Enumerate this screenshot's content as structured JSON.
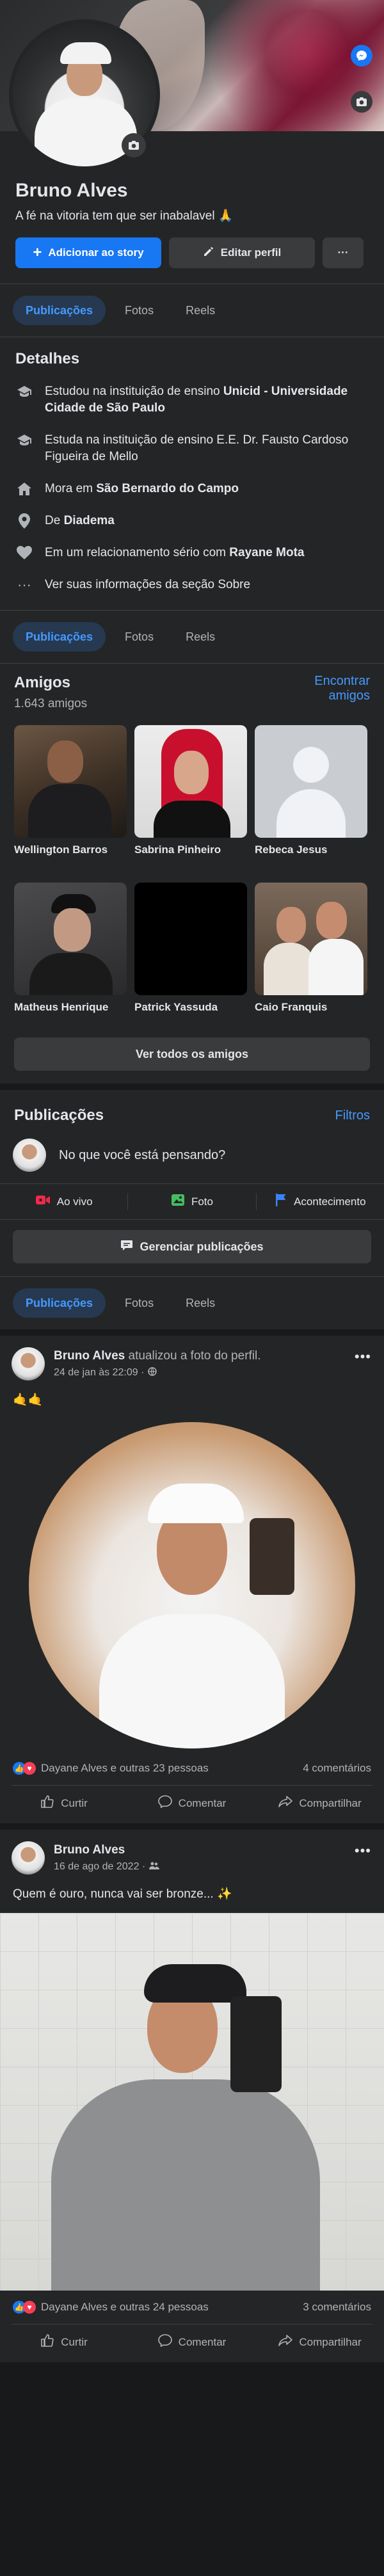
{
  "profile": {
    "name": "Bruno Alves",
    "bio": "A fé na vitoria tem que ser inabalavel 🙏",
    "add_story": "Adicionar ao story",
    "edit_profile": "Editar perfil",
    "more": "···"
  },
  "tabs": [
    "Publicações",
    "Fotos",
    "Reels"
  ],
  "details": {
    "title": "Detalhes",
    "items": [
      {
        "icon": "graduation-cap-icon",
        "pre": "Estudou na instituição de ensino ",
        "bold": "Unicid - Universidade Cidade de São Paulo",
        "post": ""
      },
      {
        "icon": "graduation-cap-icon",
        "pre": "Estuda na instituição de ensino E.E. Dr. Fausto Cardoso Figueira de Mello",
        "bold": "",
        "post": ""
      },
      {
        "icon": "home-icon",
        "pre": "Mora em ",
        "bold": "São Bernardo do Campo",
        "post": ""
      },
      {
        "icon": "location-pin-icon",
        "pre": "De ",
        "bold": "Diadema",
        "post": ""
      },
      {
        "icon": "heart-icon",
        "pre": "Em um relacionamento sério com ",
        "bold": "Rayane Mota",
        "post": ""
      },
      {
        "icon": "more-dots-icon",
        "pre": "Ver suas informações da seção Sobre",
        "bold": "",
        "post": ""
      }
    ]
  },
  "friends": {
    "title": "Amigos",
    "count": "1.643 amigos",
    "find": "Encontrar amigos",
    "see_all": "Ver todos os amigos",
    "list": [
      {
        "name": "Wellington Barros",
        "bg": "#4a3b2e"
      },
      {
        "name": "Sabrina Pinheiro",
        "bg": "#c23b4f"
      },
      {
        "name": "Rebeca Jesus",
        "bg": "#c7ccd1"
      },
      {
        "name": "Matheus Henrique",
        "bg": "#3a3a3c"
      },
      {
        "name": "Patrick Yassuda",
        "bg": "#000000"
      },
      {
        "name": "Caio Franquis",
        "bg": "#6b5a4a"
      }
    ]
  },
  "posts_section": {
    "title": "Publicações",
    "filters": "Filtros",
    "composer_placeholder": "No que você está pensando?",
    "live": "Ao vivo",
    "photo": "Foto",
    "event": "Acontecimento",
    "manage": "Gerenciar publicações"
  },
  "posts": [
    {
      "author": "Bruno Alves",
      "action": " atualizou a foto do perfil.",
      "date": "24 de jan às 22:09 ·",
      "text": "🤙🤙",
      "reactions": "Dayane Alves e outras 23 pessoas",
      "comments": "4 comentários"
    },
    {
      "author": "Bruno Alves",
      "action": "",
      "date": "16 de ago de 2022 ·",
      "text": "Quem é ouro, nunca vai ser bronze... ✨",
      "reactions": "Dayane Alves e outras 24 pessoas",
      "comments": "3 comentários"
    }
  ],
  "post_actions": {
    "like": "Curtir",
    "comment": "Comentar",
    "share": "Compartilhar"
  },
  "colors": {
    "bg": "#18191a",
    "card": "#242526",
    "accent": "#1877f2",
    "link": "#4599ff"
  }
}
